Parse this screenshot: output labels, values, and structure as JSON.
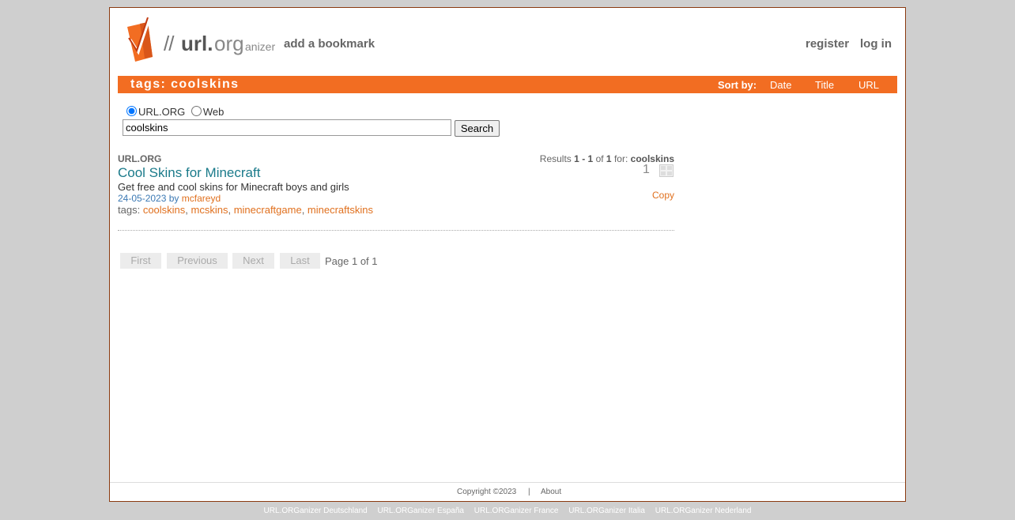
{
  "header": {
    "logo_text": "//url.organizer",
    "add_bookmark": "add a bookmark",
    "register": "register",
    "login": "log in"
  },
  "tagbar": {
    "title": "tags: coolskins",
    "sort_label": "Sort by:",
    "sort_date": "Date",
    "sort_title": "Title",
    "sort_url": "URL"
  },
  "search": {
    "scope_urlorg": "URL.ORG",
    "scope_web": "Web",
    "value": "coolskins",
    "button": "Search"
  },
  "results": {
    "source": "URL.ORG",
    "count_prefix": "Results",
    "from": "1",
    "dash": "-",
    "to": "1",
    "of_label": "of",
    "total": "1",
    "for_label": "for:",
    "query": "coolskins",
    "items": [
      {
        "title": "Cool Skins for Minecraft",
        "description": "Get free and cool skins for Minecraft boys and girls",
        "date": "24-05-2023",
        "by_label": "by",
        "user": "mcfareyd",
        "tags_label": "tags:",
        "tags": [
          "coolskins",
          "mcskins",
          "minecraftgame",
          "minecraftskins"
        ],
        "count": "1",
        "copy": "Copy"
      }
    ]
  },
  "pagination": {
    "first": "First",
    "previous": "Previous",
    "next": "Next",
    "last": "Last",
    "info": "Page 1 of 1"
  },
  "footer": {
    "copyright": "Copyright ©2023",
    "separator": "|",
    "about": "About",
    "intl": [
      "URL.ORGanizer Deutschland",
      "URL.ORGanizer España",
      "URL.ORGanizer France",
      "URL.ORGanizer Italia",
      "URL.ORGanizer Nederland"
    ]
  },
  "colors": {
    "accent": "#f26d22",
    "link_orange": "#e0701e",
    "title_teal": "#1a7a8a",
    "meta_blue": "#3b79b4",
    "background": "#cfcfcf"
  }
}
